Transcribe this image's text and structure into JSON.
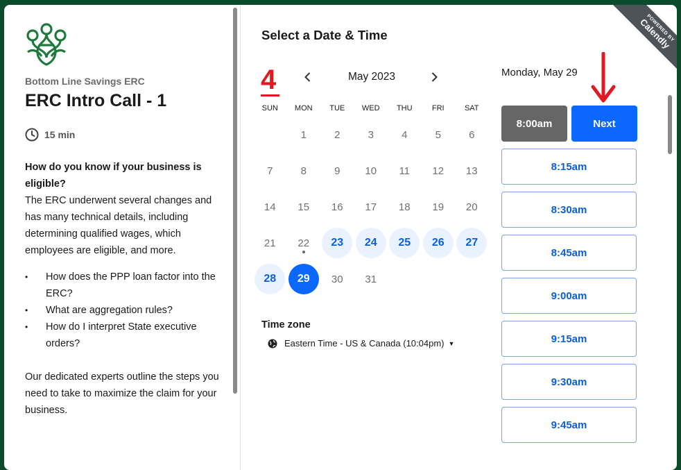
{
  "organizer": "Bottom Line Savings ERC",
  "event": {
    "title": "ERC Intro Call - 1",
    "duration": "15 min"
  },
  "description": {
    "question": "How do you know if your business is eligible?",
    "body": "The ERC underwent several changes and has many technical details, including determining qualified wages, which employees are eligible, and more.",
    "bullets": [
      "How does the PPP loan factor into the ERC?",
      "What are aggregation rules?",
      "How do I interpret State executive orders?"
    ],
    "closing": "Our dedicated experts outline the steps you need to take to maximize the claim for your business."
  },
  "scheduler": {
    "heading": "Select a Date & Time",
    "step_annotation": "4",
    "month_label": "May 2023",
    "weekdays": [
      "SUN",
      "MON",
      "TUE",
      "WED",
      "THU",
      "FRI",
      "SAT"
    ],
    "weeks": [
      [
        {
          "d": ""
        },
        {
          "d": "1"
        },
        {
          "d": "2"
        },
        {
          "d": "3"
        },
        {
          "d": "4"
        },
        {
          "d": "5"
        },
        {
          "d": "6"
        }
      ],
      [
        {
          "d": "7"
        },
        {
          "d": "8"
        },
        {
          "d": "9"
        },
        {
          "d": "10"
        },
        {
          "d": "11"
        },
        {
          "d": "12"
        },
        {
          "d": "13"
        }
      ],
      [
        {
          "d": "14"
        },
        {
          "d": "15"
        },
        {
          "d": "16"
        },
        {
          "d": "17"
        },
        {
          "d": "18"
        },
        {
          "d": "19"
        },
        {
          "d": "20"
        }
      ],
      [
        {
          "d": "21"
        },
        {
          "d": "22",
          "today": true
        },
        {
          "d": "23",
          "avail": true
        },
        {
          "d": "24",
          "avail": true
        },
        {
          "d": "25",
          "avail": true
        },
        {
          "d": "26",
          "avail": true
        },
        {
          "d": "27",
          "avail": true
        }
      ],
      [
        {
          "d": "28",
          "avail": true
        },
        {
          "d": "29",
          "selected": true
        },
        {
          "d": "30"
        },
        {
          "d": "31"
        },
        {
          "d": ""
        },
        {
          "d": ""
        },
        {
          "d": ""
        }
      ]
    ],
    "timezone_label": "Time zone",
    "timezone_value": "Eastern Time - US & Canada (10:04pm)",
    "selected_date": "Monday, May 29",
    "selected_time": "8:00am",
    "next_label": "Next",
    "times": [
      "8:15am",
      "8:30am",
      "8:45am",
      "9:00am",
      "9:15am",
      "9:30am",
      "9:45am"
    ]
  },
  "badge": {
    "powered_by": "POWERED BY",
    "brand": "Calendly"
  },
  "colors": {
    "accent": "#0a67ff",
    "annotation": "#e01a22",
    "frame": "#0b4a2a"
  }
}
